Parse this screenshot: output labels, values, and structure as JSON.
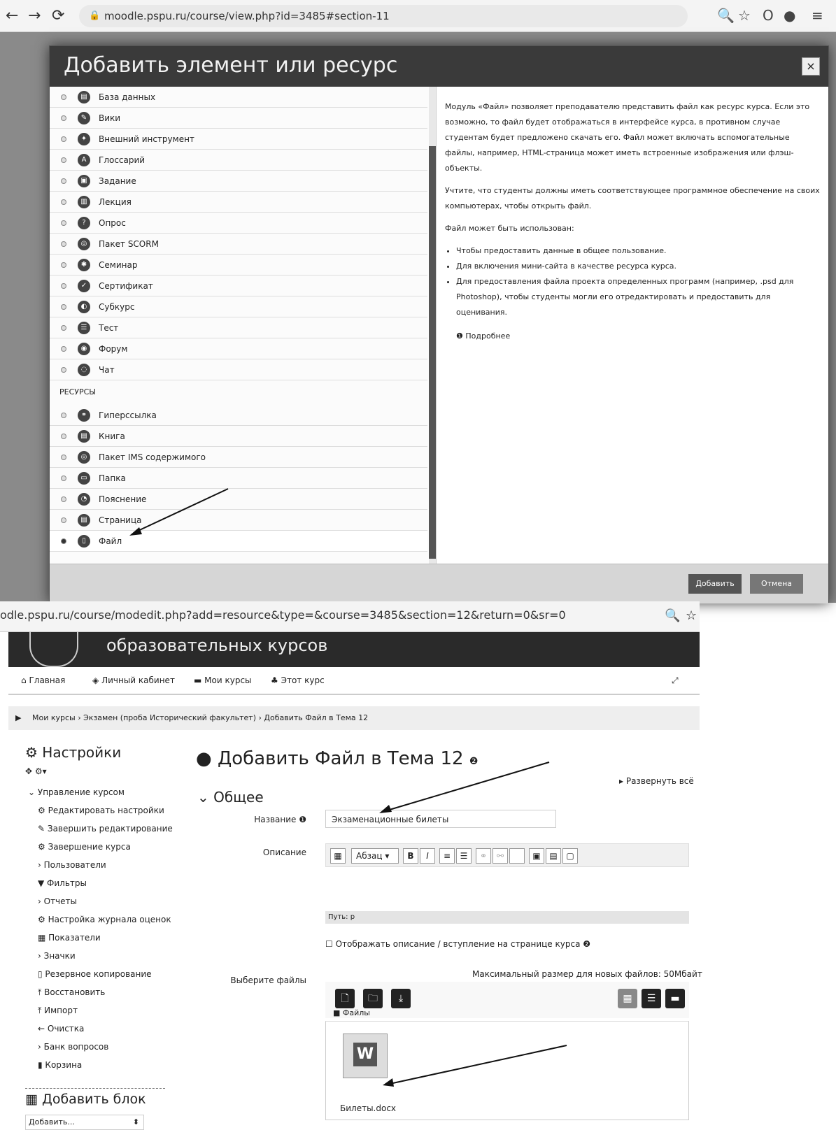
{
  "browser1": {
    "url": "moodle.pspu.ru/course/view.php?id=3485#section-11"
  },
  "modal": {
    "title": "Добавить элемент или ресурс",
    "close": "×",
    "activities": [
      "База данных",
      "Вики",
      "Внешний инструмент",
      "Глоссарий",
      "Задание",
      "Лекция",
      "Опрос",
      "Пакет SCORM",
      "Семинар",
      "Сертификат",
      "Субкурс",
      "Тест",
      "Форум",
      "Чат"
    ],
    "section_resources": "РЕСУРСЫ",
    "resources": [
      "Гиперссылка",
      "Книга",
      "Пакет IMS содержимого",
      "Папка",
      "Пояснение",
      "Страница",
      "Файл"
    ],
    "description": {
      "p1": "Модуль «Файл» позволяет преподавателю представить файл как ресурс курса. Если это возможно, то файл будет отображаться в интерфейсе курса, в противном случае студентам будет предложено скачать его. Файл может включать вспомогательные файлы, например, HTML-страница может иметь встроенные изображения или флэш-объекты.",
      "p2": "Учтите, что студенты должны иметь соответствующее программное обеспечение на своих компьютерах, чтобы открыть файл.",
      "p3": "Файл может быть использован:",
      "li1": "Чтобы предоставить данные в общее пользование.",
      "li2": "Для включения мини-сайта в качестве ресурса курса.",
      "li3": "Для предоставления файла проекта определенных программ (например, .psd для Photoshop), чтобы студенты могли его отредактировать и предоставить для оценивания.",
      "more": "Подробнее"
    },
    "add_label": "Добавить",
    "cancel_label": "Отмена"
  },
  "browser2": {
    "url": "odle.pspu.ru/course/modedit.php?add=resource&type=&course=3485&section=12&return=0&sr=0"
  },
  "site": {
    "banner": "образовательных курсов"
  },
  "nav": {
    "home": "Главная",
    "cabinet": "Личный кабинет",
    "mycourses": "Мои курсы",
    "thiscourse": "Этот курс"
  },
  "breadcrumb": "Мои курсы › Экзамен (проба Исторический факультет) › Добавить Файл в Тема 12",
  "settings": {
    "title": "Настройки",
    "manage": "Управление курсом",
    "items": [
      "Редактировать настройки",
      "Завершить редактирование",
      "Завершение курса",
      "Пользователи",
      "Фильтры",
      "Отчеты",
      "Настройка журнала оценок",
      "Показатели",
      "Значки",
      "Резервное копирование",
      "Восстановить",
      "Импорт",
      "Очистка",
      "Банк вопросов",
      "Корзина"
    ],
    "add_block": "Добавить блок",
    "add_select": "Добавить..."
  },
  "form": {
    "title": "Добавить Файл в Тема 12",
    "expand": "Развернуть всё",
    "section": "Общее",
    "name_label": "Название",
    "name_value": "Экзаменационные билеты",
    "desc_label": "Описание",
    "editor_para": "Абзац",
    "path": "Путь: p",
    "show_desc": "Отображать описание / вступление на странице курса",
    "files_label": "Выберите файлы",
    "max_size": "Максимальный размер для новых файлов: 50Мбайт",
    "files_folder": "Файлы",
    "file_name": "Билеты.docx"
  }
}
